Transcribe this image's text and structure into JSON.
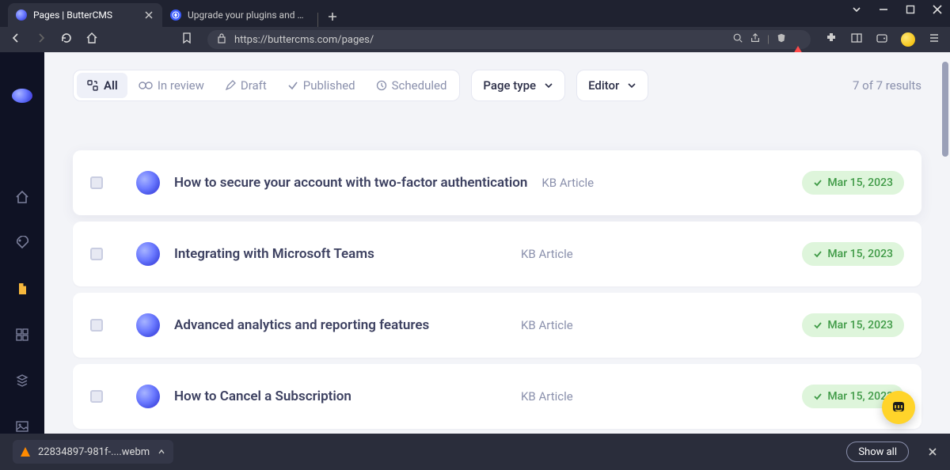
{
  "tabs": {
    "active": {
      "label": "Pages | ButterCMS"
    },
    "second": {
      "label": "Upgrade your plugins and maximize y"
    }
  },
  "url": "https://buttercms.com/pages/",
  "filters": {
    "all": "All",
    "in_review": "In review",
    "draft": "Draft",
    "published": "Published",
    "scheduled": "Scheduled"
  },
  "dropdowns": {
    "page_type": "Page type",
    "editor": "Editor"
  },
  "results_count": "7 of 7 results",
  "pages": [
    {
      "title": "How to secure your account with two-factor authentication",
      "category": "KB Article",
      "date": "Mar 15, 2023"
    },
    {
      "title": "Integrating with Microsoft Teams",
      "category": "KB Article",
      "date": "Mar 15, 2023"
    },
    {
      "title": "Advanced analytics and reporting features",
      "category": "KB Article",
      "date": "Mar 15, 2023"
    },
    {
      "title": "How to Cancel a Subscription",
      "category": "KB Article",
      "date": "Mar 15, 2023"
    }
  ],
  "download": {
    "filename": "22834897-981f-....webm",
    "show_all": "Show all"
  }
}
